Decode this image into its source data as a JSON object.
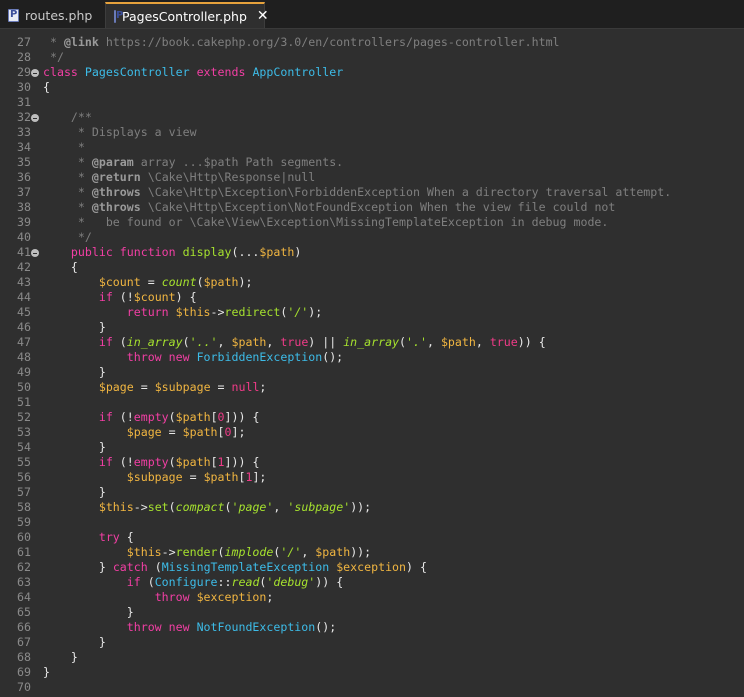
{
  "tabs": [
    {
      "label": "routes.php",
      "active": false
    },
    {
      "label": "PagesController.php",
      "active": true
    }
  ],
  "close_glyph": "✕",
  "editor": {
    "lines": [
      {
        "n": "27",
        "t": [
          [
            "c",
            " * "
          ],
          [
            "cs",
            "@link"
          ],
          [
            "c",
            " https://book.cakephp.org/3.0/en/controllers/pages-controller.html"
          ]
        ]
      },
      {
        "n": "28",
        "t": [
          [
            "c",
            " */"
          ]
        ]
      },
      {
        "n": "29",
        "fold": true,
        "t": [
          [
            "kw",
            "class"
          ],
          [
            "op",
            " "
          ],
          [
            "cls",
            "PagesController"
          ],
          [
            "op",
            " "
          ],
          [
            "kw",
            "extends"
          ],
          [
            "op",
            " "
          ],
          [
            "cls",
            "AppController"
          ]
        ]
      },
      {
        "n": "30",
        "t": [
          [
            "op",
            "{"
          ]
        ]
      },
      {
        "n": "31",
        "t": []
      },
      {
        "n": "32",
        "fold": true,
        "t": [
          [
            "c",
            "    /**"
          ]
        ]
      },
      {
        "n": "33",
        "t": [
          [
            "c",
            "     * Displays a view"
          ]
        ]
      },
      {
        "n": "34",
        "t": [
          [
            "c",
            "     *"
          ]
        ]
      },
      {
        "n": "35",
        "t": [
          [
            "c",
            "     * "
          ],
          [
            "cs",
            "@param"
          ],
          [
            "c",
            " array ...$path Path segments."
          ]
        ]
      },
      {
        "n": "36",
        "t": [
          [
            "c",
            "     * "
          ],
          [
            "cs",
            "@return"
          ],
          [
            "c",
            " \\Cake\\Http\\Response|null"
          ]
        ]
      },
      {
        "n": "37",
        "t": [
          [
            "c",
            "     * "
          ],
          [
            "cs",
            "@throws"
          ],
          [
            "c",
            " \\Cake\\Http\\Exception\\ForbiddenException When a directory traversal attempt."
          ]
        ]
      },
      {
        "n": "38",
        "t": [
          [
            "c",
            "     * "
          ],
          [
            "cs",
            "@throws"
          ],
          [
            "c",
            " \\Cake\\Http\\Exception\\NotFoundException When the view file could not"
          ]
        ]
      },
      {
        "n": "39",
        "t": [
          [
            "c",
            "     *   be found or \\Cake\\View\\Exception\\MissingTemplateException in debug mode."
          ]
        ]
      },
      {
        "n": "40",
        "t": [
          [
            "c",
            "     */"
          ]
        ]
      },
      {
        "n": "41",
        "fold": true,
        "t": [
          [
            "op",
            "    "
          ],
          [
            "kw",
            "public function"
          ],
          [
            "op",
            " "
          ],
          [
            "fn",
            "display"
          ],
          [
            "op",
            "(..."
          ],
          [
            "var",
            "$path"
          ],
          [
            "op",
            ")"
          ]
        ]
      },
      {
        "n": "42",
        "t": [
          [
            "op",
            "    {"
          ]
        ]
      },
      {
        "n": "43",
        "t": [
          [
            "op",
            "        "
          ],
          [
            "var",
            "$count"
          ],
          [
            "op",
            " = "
          ],
          [
            "fn it",
            "count"
          ],
          [
            "op",
            "("
          ],
          [
            "var",
            "$path"
          ],
          [
            "op",
            ");"
          ]
        ]
      },
      {
        "n": "44",
        "t": [
          [
            "op",
            "        "
          ],
          [
            "kw",
            "if"
          ],
          [
            "op",
            " (!"
          ],
          [
            "var",
            "$count"
          ],
          [
            "op",
            ") {"
          ]
        ]
      },
      {
        "n": "45",
        "t": [
          [
            "op",
            "            "
          ],
          [
            "kw",
            "return"
          ],
          [
            "op",
            " "
          ],
          [
            "var",
            "$this"
          ],
          [
            "op",
            "->"
          ],
          [
            "fn",
            "redirect"
          ],
          [
            "op",
            "("
          ],
          [
            "str",
            "'/'"
          ],
          [
            "op",
            ");"
          ]
        ]
      },
      {
        "n": "46",
        "t": [
          [
            "op",
            "        }"
          ]
        ]
      },
      {
        "n": "47",
        "t": [
          [
            "op",
            "        "
          ],
          [
            "kw",
            "if"
          ],
          [
            "op",
            " ("
          ],
          [
            "fn it",
            "in_array"
          ],
          [
            "op",
            "("
          ],
          [
            "str",
            "'..'"
          ],
          [
            "op",
            ", "
          ],
          [
            "var",
            "$path"
          ],
          [
            "op",
            ", "
          ],
          [
            "n",
            "true"
          ],
          [
            "op",
            ") || "
          ],
          [
            "fn it",
            "in_array"
          ],
          [
            "op",
            "("
          ],
          [
            "str",
            "'.'"
          ],
          [
            "op",
            ", "
          ],
          [
            "var",
            "$path"
          ],
          [
            "op",
            ", "
          ],
          [
            "n",
            "true"
          ],
          [
            "op",
            ")) {"
          ]
        ]
      },
      {
        "n": "48",
        "t": [
          [
            "op",
            "            "
          ],
          [
            "kw",
            "throw new"
          ],
          [
            "op",
            " "
          ],
          [
            "cls",
            "ForbiddenException"
          ],
          [
            "op",
            "();"
          ]
        ]
      },
      {
        "n": "49",
        "t": [
          [
            "op",
            "        }"
          ]
        ]
      },
      {
        "n": "50",
        "t": [
          [
            "op",
            "        "
          ],
          [
            "var",
            "$page"
          ],
          [
            "op",
            " = "
          ],
          [
            "var",
            "$subpage"
          ],
          [
            "op",
            " = "
          ],
          [
            "n",
            "null"
          ],
          [
            "op",
            ";"
          ]
        ]
      },
      {
        "n": "51",
        "t": []
      },
      {
        "n": "52",
        "t": [
          [
            "op",
            "        "
          ],
          [
            "kw",
            "if"
          ],
          [
            "op",
            " (!"
          ],
          [
            "kw",
            "empty"
          ],
          [
            "op",
            "("
          ],
          [
            "var",
            "$path"
          ],
          [
            "op",
            "["
          ],
          [
            "n",
            "0"
          ],
          [
            "op",
            "])) {"
          ]
        ]
      },
      {
        "n": "53",
        "t": [
          [
            "op",
            "            "
          ],
          [
            "var",
            "$page"
          ],
          [
            "op",
            " = "
          ],
          [
            "var",
            "$path"
          ],
          [
            "op",
            "["
          ],
          [
            "n",
            "0"
          ],
          [
            "op",
            "];"
          ]
        ]
      },
      {
        "n": "54",
        "t": [
          [
            "op",
            "        }"
          ]
        ]
      },
      {
        "n": "55",
        "t": [
          [
            "op",
            "        "
          ],
          [
            "kw",
            "if"
          ],
          [
            "op",
            " (!"
          ],
          [
            "kw",
            "empty"
          ],
          [
            "op",
            "("
          ],
          [
            "var",
            "$path"
          ],
          [
            "op",
            "["
          ],
          [
            "n",
            "1"
          ],
          [
            "op",
            "])) {"
          ]
        ]
      },
      {
        "n": "56",
        "t": [
          [
            "op",
            "            "
          ],
          [
            "var",
            "$subpage"
          ],
          [
            "op",
            " = "
          ],
          [
            "var",
            "$path"
          ],
          [
            "op",
            "["
          ],
          [
            "n",
            "1"
          ],
          [
            "op",
            "];"
          ]
        ]
      },
      {
        "n": "57",
        "t": [
          [
            "op",
            "        }"
          ]
        ]
      },
      {
        "n": "58",
        "t": [
          [
            "op",
            "        "
          ],
          [
            "var",
            "$this"
          ],
          [
            "op",
            "->"
          ],
          [
            "fn",
            "set"
          ],
          [
            "op",
            "("
          ],
          [
            "fn it",
            "compact"
          ],
          [
            "op",
            "("
          ],
          [
            "str",
            "'page'"
          ],
          [
            "op",
            ", "
          ],
          [
            "str",
            "'subpage'"
          ],
          [
            "op",
            "));"
          ]
        ]
      },
      {
        "n": "59",
        "t": []
      },
      {
        "n": "60",
        "t": [
          [
            "op",
            "        "
          ],
          [
            "kw",
            "try"
          ],
          [
            "op",
            " {"
          ]
        ]
      },
      {
        "n": "61",
        "t": [
          [
            "op",
            "            "
          ],
          [
            "var",
            "$this"
          ],
          [
            "op",
            "->"
          ],
          [
            "fn",
            "render"
          ],
          [
            "op",
            "("
          ],
          [
            "fn it",
            "implode"
          ],
          [
            "op",
            "("
          ],
          [
            "str",
            "'/'"
          ],
          [
            "op",
            ", "
          ],
          [
            "var",
            "$path"
          ],
          [
            "op",
            "));"
          ]
        ]
      },
      {
        "n": "62",
        "t": [
          [
            "op",
            "        } "
          ],
          [
            "kw",
            "catch"
          ],
          [
            "op",
            " ("
          ],
          [
            "cls",
            "MissingTemplateException"
          ],
          [
            "op",
            " "
          ],
          [
            "var",
            "$exception"
          ],
          [
            "op",
            ") {"
          ]
        ]
      },
      {
        "n": "63",
        "t": [
          [
            "op",
            "            "
          ],
          [
            "kw",
            "if"
          ],
          [
            "op",
            " ("
          ],
          [
            "cls",
            "Configure"
          ],
          [
            "op",
            "::"
          ],
          [
            "fn it",
            "read"
          ],
          [
            "op",
            "("
          ],
          [
            "str",
            "'debug'"
          ],
          [
            "op",
            ")) {"
          ]
        ]
      },
      {
        "n": "64",
        "t": [
          [
            "op",
            "                "
          ],
          [
            "kw",
            "throw"
          ],
          [
            "op",
            " "
          ],
          [
            "var",
            "$exception"
          ],
          [
            "op",
            ";"
          ]
        ]
      },
      {
        "n": "65",
        "t": [
          [
            "op",
            "            }"
          ]
        ]
      },
      {
        "n": "66",
        "t": [
          [
            "op",
            "            "
          ],
          [
            "kw",
            "throw new"
          ],
          [
            "op",
            " "
          ],
          [
            "cls",
            "NotFoundException"
          ],
          [
            "op",
            "();"
          ]
        ]
      },
      {
        "n": "67",
        "t": [
          [
            "op",
            "        }"
          ]
        ]
      },
      {
        "n": "68",
        "t": [
          [
            "op",
            "    }"
          ]
        ]
      },
      {
        "n": "69",
        "t": [
          [
            "op",
            "}"
          ]
        ]
      },
      {
        "n": "70",
        "t": []
      }
    ]
  },
  "colors": {
    "background": "#2f2f2f",
    "tabbar": "#1f1f1f",
    "active_tab_accent": "#e6a23c",
    "keyword": "#f23fa4",
    "class": "#3dbce8",
    "function": "#a6e22e",
    "variable": "#f0b541",
    "comment": "#7f7f7f"
  }
}
